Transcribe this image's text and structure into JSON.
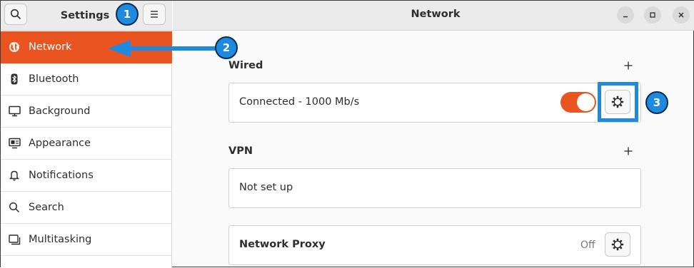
{
  "sidebar": {
    "title": "Settings",
    "items": [
      {
        "label": "Network",
        "icon": "globe-icon",
        "active": true
      },
      {
        "label": "Bluetooth",
        "icon": "bluetooth-icon"
      },
      {
        "label": "Background",
        "icon": "monitor-icon"
      },
      {
        "label": "Appearance",
        "icon": "appearance-icon"
      },
      {
        "label": "Notifications",
        "icon": "bell-icon"
      },
      {
        "label": "Search",
        "icon": "search-icon"
      },
      {
        "label": "Multitasking",
        "icon": "multitasking-icon"
      }
    ]
  },
  "main": {
    "title": "Network",
    "wired": {
      "section_label": "Wired",
      "status": "Connected - 1000 Mb/s",
      "toggle_on": true
    },
    "vpn": {
      "section_label": "VPN",
      "status": "Not set up"
    },
    "proxy": {
      "label": "Network Proxy",
      "status": "Off"
    }
  },
  "annotations": {
    "badge1": "1",
    "badge2": "2",
    "badge3": "3"
  },
  "colors": {
    "accent": "#e95420",
    "annotation": "#1d8ae0"
  }
}
